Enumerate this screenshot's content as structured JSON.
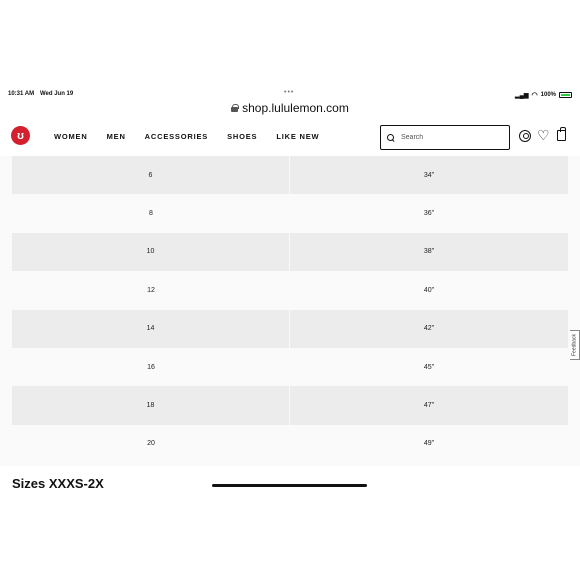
{
  "status_bar": {
    "time": "10:31 AM",
    "date": "Wed Jun 19",
    "dots": "•••",
    "battery": "100%"
  },
  "browser": {
    "url": "shop.lululemon.com"
  },
  "nav": {
    "logo_glyph": "ʊ",
    "items": [
      "WOMEN",
      "MEN",
      "ACCESSORIES",
      "SHOES",
      "LIKE NEW"
    ],
    "search_placeholder": "Search",
    "heart_glyph": "♡"
  },
  "size_table": {
    "rows": [
      {
        "size": "6",
        "measurement": "34\""
      },
      {
        "size": "8",
        "measurement": "36\""
      },
      {
        "size": "10",
        "measurement": "38\""
      },
      {
        "size": "12",
        "measurement": "40\""
      },
      {
        "size": "14",
        "measurement": "42\""
      },
      {
        "size": "16",
        "measurement": "45\""
      },
      {
        "size": "18",
        "measurement": "47\""
      },
      {
        "size": "20",
        "measurement": "49\""
      }
    ]
  },
  "feedback_label": "Feedback",
  "section_heading": "Sizes XXXS-2X",
  "colors": {
    "brand_red": "#d31f2e",
    "row_shade": "#ececec"
  }
}
